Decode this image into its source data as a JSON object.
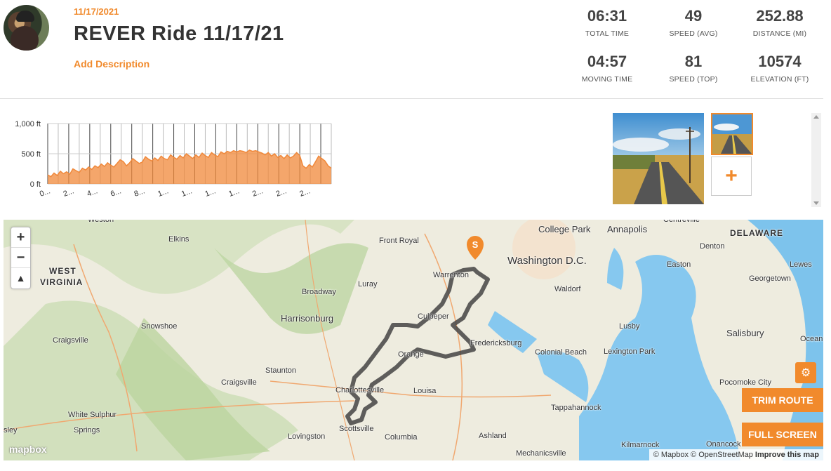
{
  "ride": {
    "date": "11/17/2021",
    "title": "REVER Ride 11/17/21",
    "add_description": "Add Description"
  },
  "stats": [
    {
      "value": "06:31",
      "label": "TOTAL TIME"
    },
    {
      "value": "49",
      "label": "SPEED (AVG)"
    },
    {
      "value": "252.88",
      "label": "DISTANCE (MI)"
    },
    {
      "value": "04:57",
      "label": "MOVING TIME"
    },
    {
      "value": "81",
      "label": "SPEED (TOP)"
    },
    {
      "value": "10574",
      "label": "ELEVATION (FT)"
    }
  ],
  "chart_data": {
    "type": "area",
    "ylabels": [
      "1,000 ft",
      "500 ft",
      "0 ft"
    ],
    "ylim": [
      0,
      1000
    ],
    "xlabels": [
      "0...",
      "2...",
      "4...",
      "6...",
      "8...",
      "1...",
      "1...",
      "1...",
      "1...",
      "2...",
      "2...",
      "2..."
    ],
    "values": [
      150,
      120,
      180,
      140,
      210,
      170,
      200,
      160,
      250,
      220,
      190,
      260,
      230,
      280,
      240,
      300,
      270,
      330,
      290,
      350,
      310,
      280,
      340,
      400,
      370,
      300,
      350,
      420,
      380,
      340,
      360,
      450,
      410,
      380,
      430,
      390,
      460,
      420,
      400,
      480,
      440,
      410,
      470,
      430,
      500,
      460,
      420,
      480,
      440,
      510,
      470,
      440,
      520,
      480,
      450,
      530,
      500,
      540,
      520,
      550,
      530,
      550,
      540,
      520,
      560,
      540,
      550,
      530,
      510,
      480,
      520,
      460,
      500,
      440,
      470,
      420,
      480,
      430,
      460,
      520,
      470,
      300,
      260,
      320,
      280,
      370,
      460,
      420,
      380,
      300,
      260
    ],
    "color": "#f0883a"
  },
  "photos": {
    "add_label": "+"
  },
  "map": {
    "zoom_in": "+",
    "zoom_out": "−",
    "compass": "▲",
    "start_marker": "S",
    "trim_route": "TRIM ROUTE",
    "full_screen": "FULL SCREEN",
    "filter_icon": "⚙",
    "mapbox": "mapbox",
    "attribution": "© Mapbox © OpenStreetMap",
    "improve": "Improve this map",
    "labels": [
      {
        "t": "Weston"
      },
      {
        "t": "Elkins"
      },
      {
        "t": "WEST"
      },
      {
        "t": "VIRGINIA"
      },
      {
        "t": "Front Royal"
      },
      {
        "t": "College Park"
      },
      {
        "t": "Annapolis"
      },
      {
        "t": "Centreville"
      },
      {
        "t": "DELAWARE"
      },
      {
        "t": "Denton"
      },
      {
        "t": "Lewes"
      },
      {
        "t": "Washington D.C."
      },
      {
        "t": "Warrenton"
      },
      {
        "t": "Easton"
      },
      {
        "t": "Luray"
      },
      {
        "t": "Broadway"
      },
      {
        "t": "Waldorf"
      },
      {
        "t": "Georgetown"
      },
      {
        "t": "Snowshoe"
      },
      {
        "t": "Harrisonburg"
      },
      {
        "t": "Culpeper"
      },
      {
        "t": "Lusby"
      },
      {
        "t": "Salisbury"
      },
      {
        "t": "Craigsville"
      },
      {
        "t": "Fredericksburg"
      },
      {
        "t": "Ocean Ci"
      },
      {
        "t": "Orange"
      },
      {
        "t": "Colonial Beach"
      },
      {
        "t": "Lexington Park"
      },
      {
        "t": "Staunton"
      },
      {
        "t": "Craigsville"
      },
      {
        "t": "Charlottesville"
      },
      {
        "t": "Louisa"
      },
      {
        "t": "Pocomoke City"
      },
      {
        "t": "White Sulphur"
      },
      {
        "t": "Springs"
      },
      {
        "t": "Tappahannock"
      },
      {
        "t": "Scottsville"
      },
      {
        "t": "Lovingston"
      },
      {
        "t": "Columbia"
      },
      {
        "t": "Ashland"
      },
      {
        "t": "Kilmarnock"
      },
      {
        "t": "Onancock"
      },
      {
        "t": "Mechanicsville"
      },
      {
        "t": "sley"
      }
    ]
  }
}
